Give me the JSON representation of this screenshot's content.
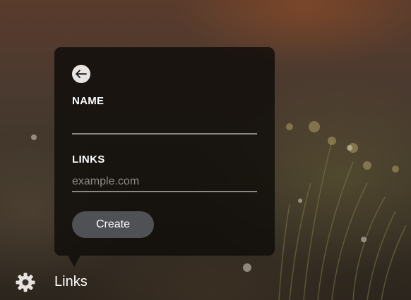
{
  "popup": {
    "back_icon": "arrow-left-icon",
    "name_label": "NAME",
    "name_value": "",
    "links_label": "LINKS",
    "links_placeholder": "example.com",
    "links_value": "",
    "create_label": "Create"
  },
  "bottom_bar": {
    "settings_icon": "gear-icon",
    "links_label": "Links"
  },
  "colors": {
    "popup_bg": "#0f0c0a",
    "button_bg": "#4f5154",
    "input_underline": "#8a8784",
    "back_button_bg": "#e8e4e1"
  }
}
